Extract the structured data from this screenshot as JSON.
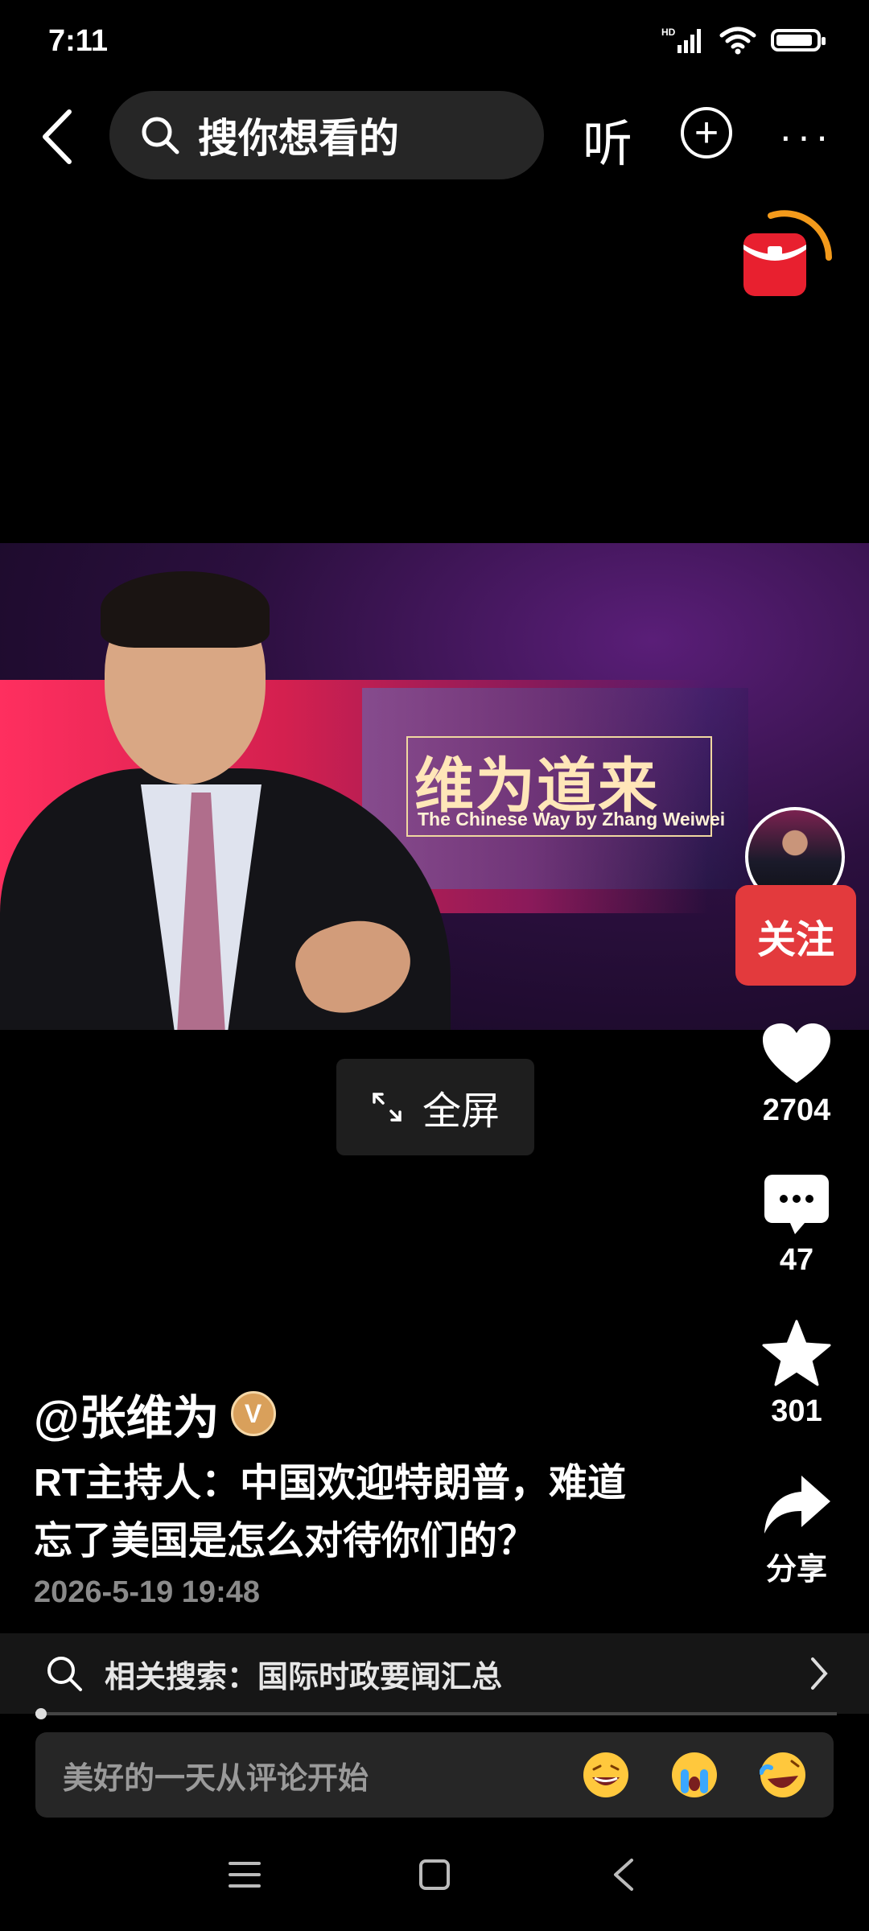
{
  "status_bar": {
    "time": "7:11",
    "network": "HD"
  },
  "top_bar": {
    "search_placeholder": "搜你想看的",
    "listen_label": "听",
    "more_label": "···"
  },
  "video": {
    "show_title_cn": "维为道来",
    "show_title_en": "The Chinese Way by Zhang Weiwei",
    "fullscreen_label": "全屏"
  },
  "actions": {
    "follow_label": "关注",
    "likes": "2704",
    "comments": "47",
    "favorites": "301",
    "share_label": "分享"
  },
  "post": {
    "author": "@张维为",
    "verified_badge": "V",
    "caption_line1": "RT主持人：中国欢迎特朗普，难道",
    "caption_line2": "忘了美国是怎么对待你们的？",
    "date": "2026-5-19 19:48"
  },
  "related_search": {
    "text": "相关搜索：国际时政要闻汇总"
  },
  "playback": {
    "progress_fraction": 0.005
  },
  "comment_bar": {
    "placeholder": "美好的一天从评论开始",
    "emojis": [
      "grin-emoji",
      "crying-emoji",
      "laugh-tears-emoji"
    ]
  },
  "colors": {
    "accent_red": "#e33a3d",
    "background": "#000000"
  }
}
